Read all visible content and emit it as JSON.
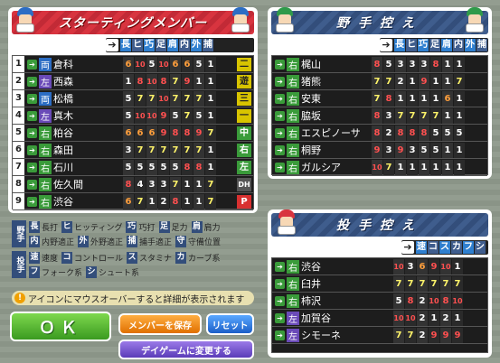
{
  "starting": {
    "title": "スターティングメンバー",
    "columns": [
      "長",
      "ヒ",
      "巧",
      "足",
      "肩",
      "内",
      "外",
      "捕"
    ],
    "rows": [
      {
        "num": "1",
        "hand": "両",
        "name": "倉科",
        "grades": [
          [
            "6",
            "o"
          ],
          [
            "10",
            "r"
          ],
          [
            "5",
            "w"
          ],
          [
            "10",
            "r"
          ],
          [
            "6",
            "o"
          ],
          [
            "6",
            "o"
          ],
          [
            "5",
            "w"
          ],
          [
            "1",
            "w"
          ]
        ],
        "pos": "二",
        "poscolor": "#d8c400"
      },
      {
        "num": "2",
        "hand": "左",
        "name": "西森",
        "grades": [
          [
            "1",
            "w"
          ],
          [
            "8",
            "r"
          ],
          [
            "10",
            "r"
          ],
          [
            "8",
            "r"
          ],
          [
            "7",
            "y"
          ],
          [
            "9",
            "r"
          ],
          [
            "1",
            "w"
          ],
          [
            "1",
            "w"
          ]
        ],
        "pos": "遊",
        "poscolor": "#d8c400"
      },
      {
        "num": "3",
        "hand": "両",
        "name": "松橋",
        "grades": [
          [
            "5",
            "w"
          ],
          [
            "7",
            "y"
          ],
          [
            "7",
            "y"
          ],
          [
            "10",
            "r"
          ],
          [
            "7",
            "y"
          ],
          [
            "7",
            "y"
          ],
          [
            "7",
            "y"
          ],
          [
            "1",
            "w"
          ]
        ],
        "pos": "三",
        "poscolor": "#d8c400"
      },
      {
        "num": "4",
        "hand": "左",
        "name": "真木",
        "grades": [
          [
            "5",
            "w"
          ],
          [
            "10",
            "r"
          ],
          [
            "10",
            "r"
          ],
          [
            "9",
            "r"
          ],
          [
            "5",
            "w"
          ],
          [
            "7",
            "y"
          ],
          [
            "5",
            "w"
          ],
          [
            "1",
            "w"
          ]
        ],
        "pos": "一",
        "poscolor": "#d8c400"
      },
      {
        "num": "5",
        "hand": "右",
        "name": "粕谷",
        "grades": [
          [
            "6",
            "o"
          ],
          [
            "6",
            "o"
          ],
          [
            "6",
            "o"
          ],
          [
            "9",
            "r"
          ],
          [
            "8",
            "r"
          ],
          [
            "8",
            "r"
          ],
          [
            "9",
            "r"
          ],
          [
            "7",
            "y"
          ]
        ],
        "pos": "中",
        "poscolor": "#3a9b3a"
      },
      {
        "num": "6",
        "hand": "右",
        "name": "森田",
        "grades": [
          [
            "3",
            "w"
          ],
          [
            "7",
            "y"
          ],
          [
            "7",
            "y"
          ],
          [
            "7",
            "y"
          ],
          [
            "7",
            "y"
          ],
          [
            "7",
            "y"
          ],
          [
            "7",
            "y"
          ],
          [
            "1",
            "w"
          ]
        ],
        "pos": "右",
        "poscolor": "#3a9b3a"
      },
      {
        "num": "7",
        "hand": "右",
        "name": "石川",
        "grades": [
          [
            "5",
            "w"
          ],
          [
            "5",
            "w"
          ],
          [
            "5",
            "w"
          ],
          [
            "5",
            "w"
          ],
          [
            "5",
            "w"
          ],
          [
            "8",
            "r"
          ],
          [
            "8",
            "r"
          ],
          [
            "1",
            "w"
          ]
        ],
        "pos": "左",
        "poscolor": "#3a9b3a"
      },
      {
        "num": "8",
        "hand": "右",
        "name": "佐久間",
        "grades": [
          [
            "8",
            "r"
          ],
          [
            "4",
            "w"
          ],
          [
            "3",
            "w"
          ],
          [
            "3",
            "w"
          ],
          [
            "7",
            "y"
          ],
          [
            "1",
            "w"
          ],
          [
            "1",
            "w"
          ],
          [
            "7",
            "y"
          ]
        ],
        "pos": "DH",
        "poscolor": "#555"
      },
      {
        "num": "9",
        "hand": "右",
        "name": "渋谷",
        "grades": [
          [
            "6",
            "o"
          ],
          [
            "7",
            "y"
          ],
          [
            "1",
            "w"
          ],
          [
            "2",
            "w"
          ],
          [
            "8",
            "r"
          ],
          [
            "1",
            "w"
          ],
          [
            "1",
            "w"
          ],
          [
            "7",
            "y"
          ]
        ],
        "pos": "P",
        "poscolor": "#d83030"
      }
    ]
  },
  "bench": {
    "title": "野手控え",
    "columns": [
      "長",
      "ヒ",
      "巧",
      "足",
      "肩",
      "内",
      "外",
      "捕"
    ],
    "rows": [
      {
        "hand": "右",
        "name": "梶山",
        "grades": [
          [
            "8",
            "r"
          ],
          [
            "5",
            "w"
          ],
          [
            "3",
            "w"
          ],
          [
            "3",
            "w"
          ],
          [
            "3",
            "w"
          ],
          [
            "8",
            "r"
          ],
          [
            "1",
            "w"
          ],
          [
            "1",
            "w"
          ]
        ]
      },
      {
        "hand": "右",
        "name": "猪熊",
        "grades": [
          [
            "7",
            "y"
          ],
          [
            "7",
            "y"
          ],
          [
            "2",
            "w"
          ],
          [
            "1",
            "w"
          ],
          [
            "9",
            "r"
          ],
          [
            "1",
            "w"
          ],
          [
            "1",
            "w"
          ],
          [
            "7",
            "y"
          ]
        ]
      },
      {
        "hand": "右",
        "name": "安東",
        "grades": [
          [
            "7",
            "y"
          ],
          [
            "8",
            "r"
          ],
          [
            "1",
            "w"
          ],
          [
            "1",
            "w"
          ],
          [
            "1",
            "w"
          ],
          [
            "1",
            "w"
          ],
          [
            "6",
            "o"
          ],
          [
            "1",
            "w"
          ]
        ]
      },
      {
        "hand": "右",
        "name": "脇坂",
        "grades": [
          [
            "8",
            "r"
          ],
          [
            "3",
            "w"
          ],
          [
            "7",
            "y"
          ],
          [
            "7",
            "y"
          ],
          [
            "7",
            "y"
          ],
          [
            "7",
            "y"
          ],
          [
            "1",
            "w"
          ],
          [
            "1",
            "w"
          ]
        ]
      },
      {
        "hand": "右",
        "name": "エスピノーサ",
        "grades": [
          [
            "8",
            "r"
          ],
          [
            "2",
            "w"
          ],
          [
            "8",
            "r"
          ],
          [
            "8",
            "r"
          ],
          [
            "8",
            "r"
          ],
          [
            "5",
            "w"
          ],
          [
            "5",
            "w"
          ],
          [
            "5",
            "w"
          ]
        ]
      },
      {
        "hand": "右",
        "name": "桐野",
        "grades": [
          [
            "9",
            "r"
          ],
          [
            "3",
            "w"
          ],
          [
            "9",
            "r"
          ],
          [
            "3",
            "w"
          ],
          [
            "5",
            "w"
          ],
          [
            "5",
            "w"
          ],
          [
            "1",
            "w"
          ],
          [
            "1",
            "w"
          ]
        ]
      },
      {
        "hand": "右",
        "name": "ガルシア",
        "grades": [
          [
            "10",
            "r"
          ],
          [
            "7",
            "y"
          ],
          [
            "1",
            "w"
          ],
          [
            "1",
            "w"
          ],
          [
            "1",
            "w"
          ],
          [
            "1",
            "w"
          ],
          [
            "1",
            "w"
          ],
          [
            "1",
            "w"
          ]
        ]
      }
    ]
  },
  "pitchers": {
    "title": "投手控え",
    "columns": [
      "速",
      "コ",
      "ス",
      "カ",
      "フ",
      "シ"
    ],
    "rows": [
      {
        "hand": "右",
        "name": "渋谷",
        "grades": [
          [
            "10",
            "r"
          ],
          [
            "3",
            "w"
          ],
          [
            "6",
            "o"
          ],
          [
            "9",
            "r"
          ],
          [
            "10",
            "r"
          ],
          [
            "1",
            "w"
          ]
        ]
      },
      {
        "hand": "右",
        "name": "臼井",
        "grades": [
          [
            "7",
            "y"
          ],
          [
            "7",
            "y"
          ],
          [
            "7",
            "y"
          ],
          [
            "7",
            "y"
          ],
          [
            "7",
            "y"
          ],
          [
            "7",
            "y"
          ]
        ]
      },
      {
        "hand": "右",
        "name": "柿沢",
        "grades": [
          [
            "5",
            "w"
          ],
          [
            "8",
            "r"
          ],
          [
            "2",
            "w"
          ],
          [
            "10",
            "r"
          ],
          [
            "8",
            "r"
          ],
          [
            "10",
            "r"
          ]
        ]
      },
      {
        "hand": "左",
        "name": "加賀谷",
        "grades": [
          [
            "10",
            "r"
          ],
          [
            "10",
            "r"
          ],
          [
            "2",
            "w"
          ],
          [
            "1",
            "w"
          ],
          [
            "2",
            "w"
          ],
          [
            "1",
            "w"
          ]
        ]
      },
      {
        "hand": "左",
        "name": "シモーネ",
        "grades": [
          [
            "7",
            "y"
          ],
          [
            "7",
            "y"
          ],
          [
            "2",
            "w"
          ],
          [
            "9",
            "r"
          ],
          [
            "9",
            "r"
          ],
          [
            "9",
            "r"
          ]
        ]
      }
    ]
  },
  "legend": {
    "fielder_side": "野手",
    "pitcher_side": "投手",
    "lines": [
      [
        [
          "長",
          "長打"
        ],
        [
          "ヒ",
          "ヒッティング"
        ],
        [
          "巧",
          "巧打"
        ],
        [
          "足",
          "足力"
        ],
        [
          "肩",
          "肩力"
        ]
      ],
      [
        [
          "内",
          "内野適正"
        ],
        [
          "外",
          "外野適正"
        ],
        [
          "捕",
          "捕手適正"
        ],
        [
          "守",
          "守備位置"
        ]
      ],
      [
        [
          "速",
          "速度"
        ],
        [
          "コ",
          "コントロール"
        ],
        [
          "ス",
          "スタミナ"
        ],
        [
          "カ",
          "カーブ系"
        ]
      ],
      [
        [
          "フ",
          "フォーク系"
        ],
        [
          "シ",
          "シュート系"
        ]
      ]
    ]
  },
  "info_text": "アイコンにマウスオーバーすると詳細が表示されます",
  "info_icon": "!",
  "buttons": {
    "ok": "ＯＫ",
    "save": "メンバーを保存",
    "reset": "リセット",
    "day": "デイゲームに変更する"
  },
  "colors": {
    "red": "#d8343f",
    "blue": "#334e7b",
    "green": "#3a9b3a"
  }
}
